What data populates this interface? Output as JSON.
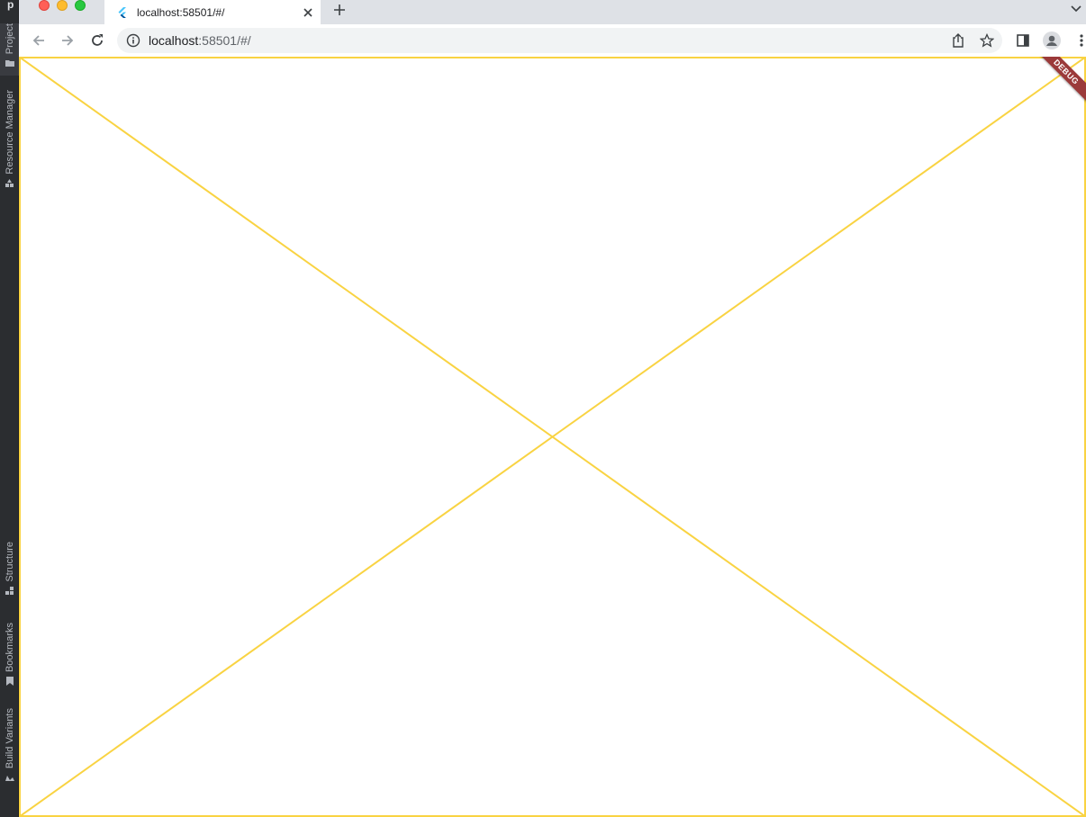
{
  "ide": {
    "logo_text": "p",
    "tools_top": [
      {
        "label": "Project",
        "icon": "folder-icon"
      },
      {
        "label": "Resource Manager",
        "icon": "resource-manager-icon"
      }
    ],
    "tools_bottom": [
      {
        "label": "Structure",
        "icon": "structure-icon"
      },
      {
        "label": "Bookmarks",
        "icon": "bookmark-icon"
      },
      {
        "label": "Build Variants",
        "icon": "build-variants-icon"
      }
    ]
  },
  "browser": {
    "tab": {
      "title": "localhost:58501/#/",
      "favicon": "flutter-icon"
    },
    "address": {
      "host": "localhost",
      "path": ":58501/#/"
    }
  },
  "flutter": {
    "debug_banner": "DEBUG",
    "placeholder_color": "#f9d342"
  }
}
